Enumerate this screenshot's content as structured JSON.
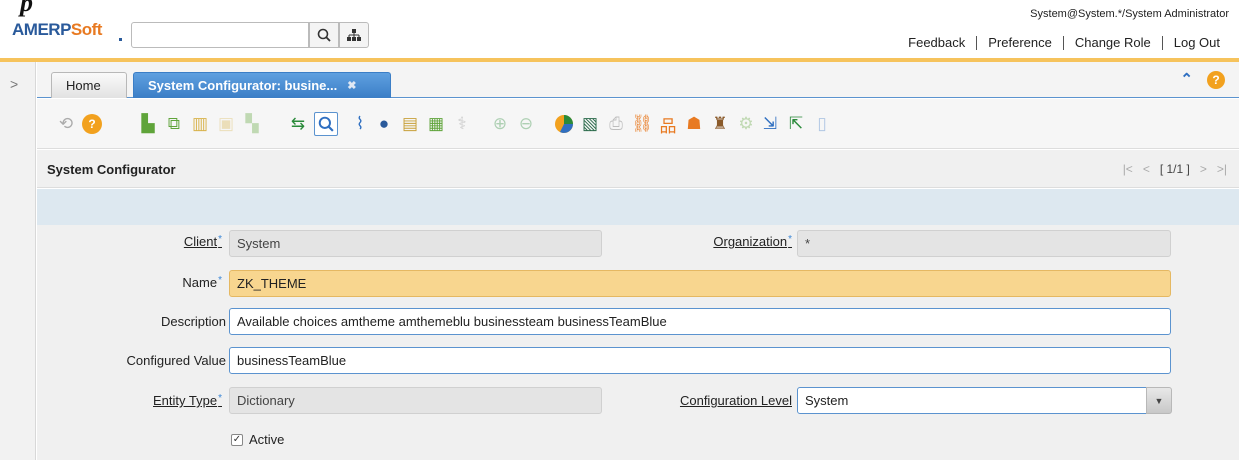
{
  "header": {
    "logo_am": "AM",
    "logo_erp": "ERP",
    "logo_soft": "Soft",
    "user_info": "System@System.*/System Administrator",
    "search_placeholder": "",
    "nav": [
      "Feedback",
      "Preference",
      "Change Role",
      "Log Out"
    ]
  },
  "tabs": {
    "home": "Home",
    "active": "System Configurator: busine...",
    "close_glyph": "✖"
  },
  "panel": {
    "title": "System Configurator",
    "pager": {
      "first": "|<",
      "prev": "<",
      "current": "[ 1/1 ]",
      "next": ">",
      "last": ">|"
    }
  },
  "form": {
    "client_label": "Client",
    "client_value": "System",
    "organization_label": "Organization",
    "organization_value": "*",
    "name_label": "Name",
    "name_value": "ZK_THEME",
    "description_label": "Description",
    "description_value": "Available choices amtheme amthemeblu businessteam businessTeamBlue",
    "configured_value_label": "Configured Value",
    "configured_value_value": "businessTeamBlue",
    "entity_type_label": "Entity Type",
    "entity_type_value": "Dictionary",
    "config_level_label": "Configuration Level",
    "config_level_value": "System",
    "active_label": "Active",
    "required_mark": "*"
  },
  "colors": {
    "accent": "#3b7ec6",
    "highlight_field": "#f8d68f",
    "header_stripe": "#f6c35c"
  }
}
